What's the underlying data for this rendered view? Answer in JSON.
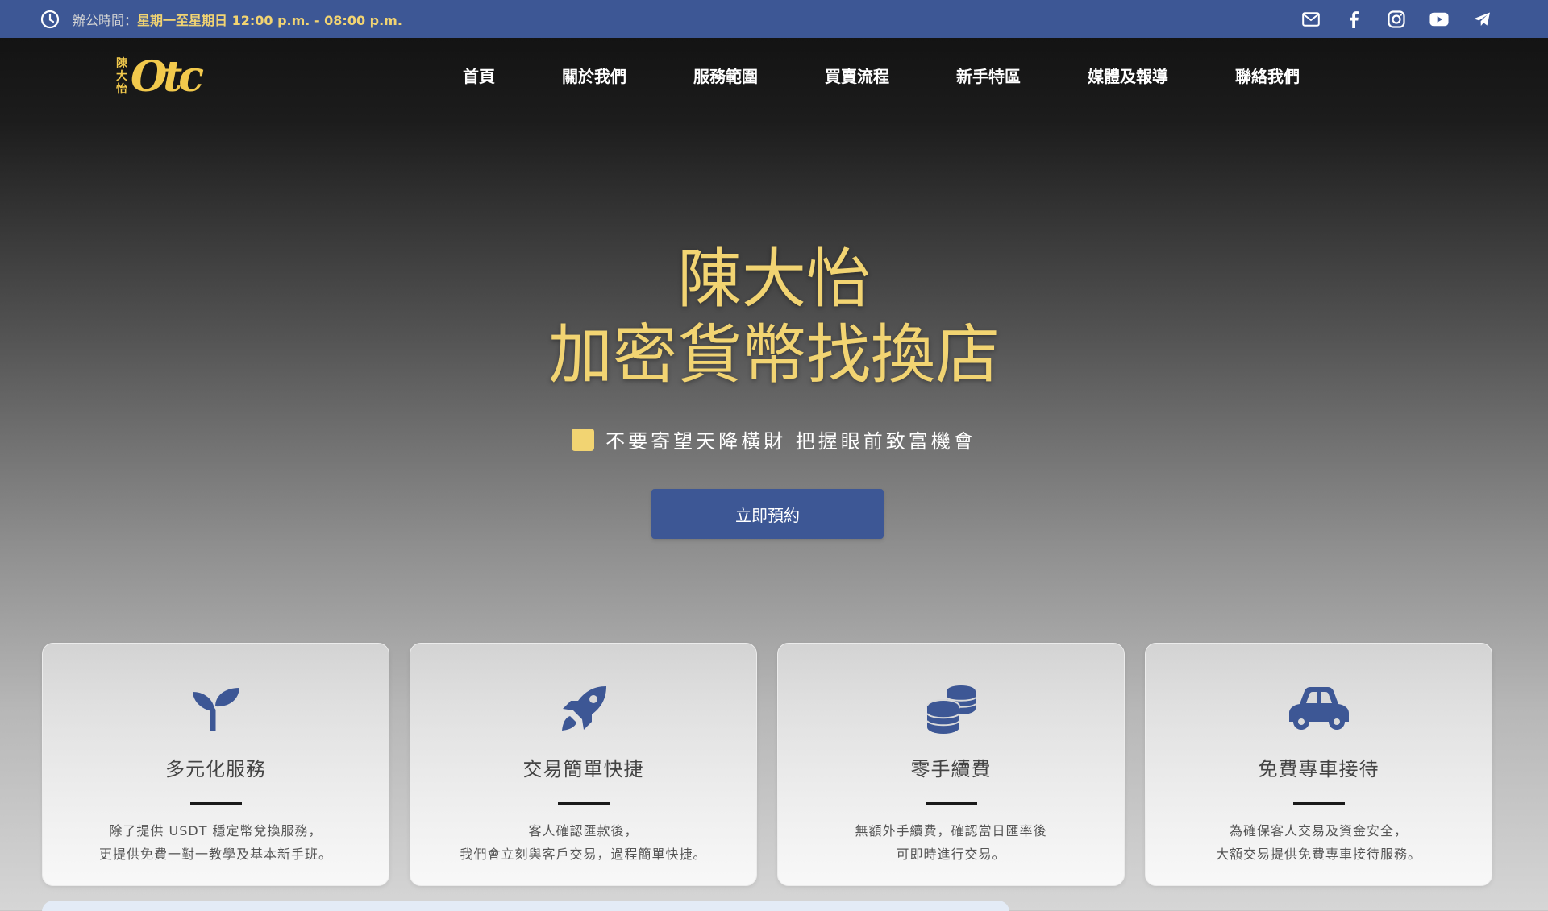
{
  "topbar": {
    "hours_label": "辦公時間：",
    "hours_value": "星期一至星期日 12:00 p.m. - 08:00 p.m.",
    "socials": [
      {
        "icon": "mail-icon"
      },
      {
        "icon": "facebook-icon"
      },
      {
        "icon": "instagram-icon"
      },
      {
        "icon": "youtube-icon"
      },
      {
        "icon": "telegram-icon"
      }
    ]
  },
  "logo": {
    "cn_line1": "陳",
    "cn_line2": "大",
    "cn_line3": "怡",
    "word": "Otc"
  },
  "nav": {
    "items": [
      "首頁",
      "關於我們",
      "服務範圍",
      "買賣流程",
      "新手特區",
      "媒體及報導",
      "聯絡我們"
    ]
  },
  "hero": {
    "title_line1": "陳大怡",
    "title_line2": "加密貨幣找換店",
    "subtitle": "不要寄望天降橫財 把握眼前致富機會",
    "cta_label": "立即預約"
  },
  "features": [
    {
      "icon": "sprout-icon",
      "title": "多元化服務",
      "desc_line1": "除了提供 USDT 穩定幣兌換服務，",
      "desc_line2": "更提供免費一對一教學及基本新手班。"
    },
    {
      "icon": "rocket-icon",
      "title": "交易簡單快捷",
      "desc_line1": "客人確認匯款後，",
      "desc_line2": "我們會立刻與客戶交易，過程簡單快捷。"
    },
    {
      "icon": "coins-icon",
      "title": "零手續費",
      "desc_line1": "無額外手續費，確認當日匯率後",
      "desc_line2": "可即時進行交易。"
    },
    {
      "icon": "car-icon",
      "title": "免費專車接待",
      "desc_line1": "為確保客人交易及資金安全，",
      "desc_line2": "大額交易提供免費專車接待服務。"
    }
  ],
  "colors": {
    "brand_blue": "#3d5795",
    "gold": "#f2d472"
  }
}
